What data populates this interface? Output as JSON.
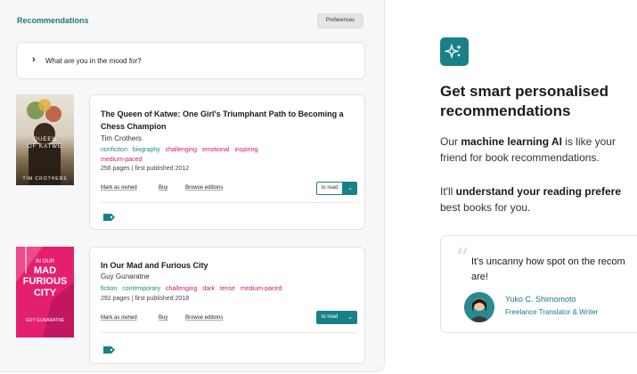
{
  "panel": {
    "title": "Recommendations",
    "preferences_label": "Preferences",
    "mood_prompt": "What are you in the mood for?"
  },
  "books": [
    {
      "title": "The Queen of Katwe: One Girl's Triumphant Path to Becoming a Chess Champion",
      "author": "Tim Crothers",
      "tags": [
        {
          "label": "nonfiction",
          "kind": "genre"
        },
        {
          "label": "biography",
          "kind": "genre"
        },
        {
          "label": "challenging",
          "kind": "mood"
        },
        {
          "label": "emotional",
          "kind": "mood"
        },
        {
          "label": "inspiring",
          "kind": "mood"
        },
        {
          "label": "medium-paced",
          "kind": "mood"
        }
      ],
      "meta": "256 pages | first published 2012",
      "cover": {
        "line1": "QUEEN",
        "line2": "OF KATWE",
        "author": "TIM CROTHERS"
      },
      "actions": {
        "owned": "Mark as owned",
        "buy": "Buy",
        "editions": "Browse editions",
        "status": "to read"
      }
    },
    {
      "title": "In Our Mad and Furious City",
      "author": "Guy Gunaratne",
      "tags": [
        {
          "label": "fiction",
          "kind": "genre"
        },
        {
          "label": "contemporary",
          "kind": "genre"
        },
        {
          "label": "challenging",
          "kind": "mood"
        },
        {
          "label": "dark",
          "kind": "mood"
        },
        {
          "label": "tense",
          "kind": "mood"
        },
        {
          "label": "medium-paced",
          "kind": "mood"
        }
      ],
      "meta": "292 pages | first published 2018",
      "cover": {
        "line1": "IN OUR",
        "line2": "MAD",
        "line3": "FURIOUS",
        "line4": "CITY",
        "author": "GUY GUNARATNE"
      },
      "actions": {
        "owned": "Mark as owned",
        "buy": "Buy",
        "editions": "Browse editions",
        "status": "to read"
      }
    }
  ],
  "promo": {
    "headline_1": "Get smart personalised",
    "headline_2": "recommendations",
    "p1_prefix": "Our ",
    "p1_bold": "machine learning AI",
    "p1_suffix": " is like your",
    "p1_line2": "friend for book recommendations.",
    "p2_prefix": "It'll ",
    "p2_bold": "understand your reading prefere",
    "p2_line2": "best books for you."
  },
  "testimonial": {
    "quote_line1": "It's uncanny how spot on the recom",
    "quote_line2": "are!",
    "name": "Yuko C. Shimomoto",
    "role": "Freelance Translator & Writer"
  },
  "colors": {
    "accent": "#1a8088",
    "mood_tag": "#d01870",
    "genre_tag": "#1a8a8a"
  },
  "icons": [
    "chevron-right-icon",
    "tag-icon",
    "chevron-down-icon",
    "sparkle-icon",
    "quote-icon"
  ]
}
